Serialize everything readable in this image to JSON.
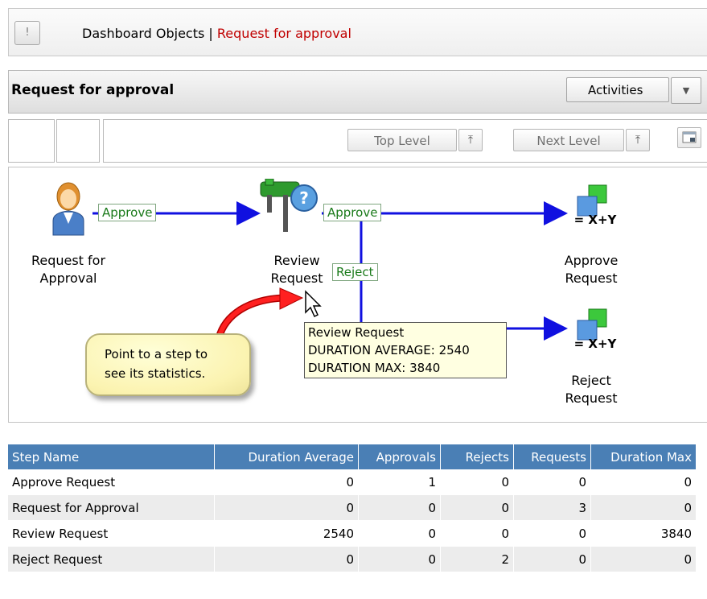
{
  "breadcrumb": {
    "alert_icon": "!",
    "root": "Dashboard Objects",
    "separator": " | ",
    "current": "Request for approval"
  },
  "header": {
    "title": "Request for approval",
    "activities_label": "Activities"
  },
  "toolbar": {
    "top_level_label": "Top Level",
    "next_level_label": "Next Level"
  },
  "diagram": {
    "nodes": {
      "request_for_approval": "Request for\nApproval",
      "review_request": "Review\nRequest",
      "approve_request": "Approve\nRequest",
      "reject_request": "Reject\nRequest"
    },
    "edges": {
      "approve_1": "Approve",
      "approve_2": "Approve",
      "reject": "Reject"
    },
    "tooltip": {
      "line1": "Review Request",
      "line2": "DURATION AVERAGE: 2540",
      "line3": "DURATION MAX: 3840"
    },
    "callout": {
      "line1": "Point to a step to",
      "line2": "see its statistics."
    },
    "formula_icon_text": "= X+Y"
  },
  "table": {
    "columns": [
      "Step Name",
      "Duration Average",
      "Approvals",
      "Rejects",
      "Requests",
      "Duration Max"
    ],
    "rows": [
      [
        "Approve Request",
        "0",
        "1",
        "0",
        "0",
        "0"
      ],
      [
        "Request for Approval",
        "0",
        "0",
        "0",
        "3",
        "0"
      ],
      [
        "Review Request",
        "2540",
        "0",
        "0",
        "0",
        "3840"
      ],
      [
        "Reject Request",
        "0",
        "0",
        "2",
        "0",
        "0"
      ]
    ]
  },
  "colors": {
    "header_blue": "#4a7fb5",
    "breadcrumb_current": "#c00000",
    "edge_label_green": "#1a7a1a",
    "arrow_blue": "#1010e0",
    "callout_arrow_red": "#e01010"
  }
}
